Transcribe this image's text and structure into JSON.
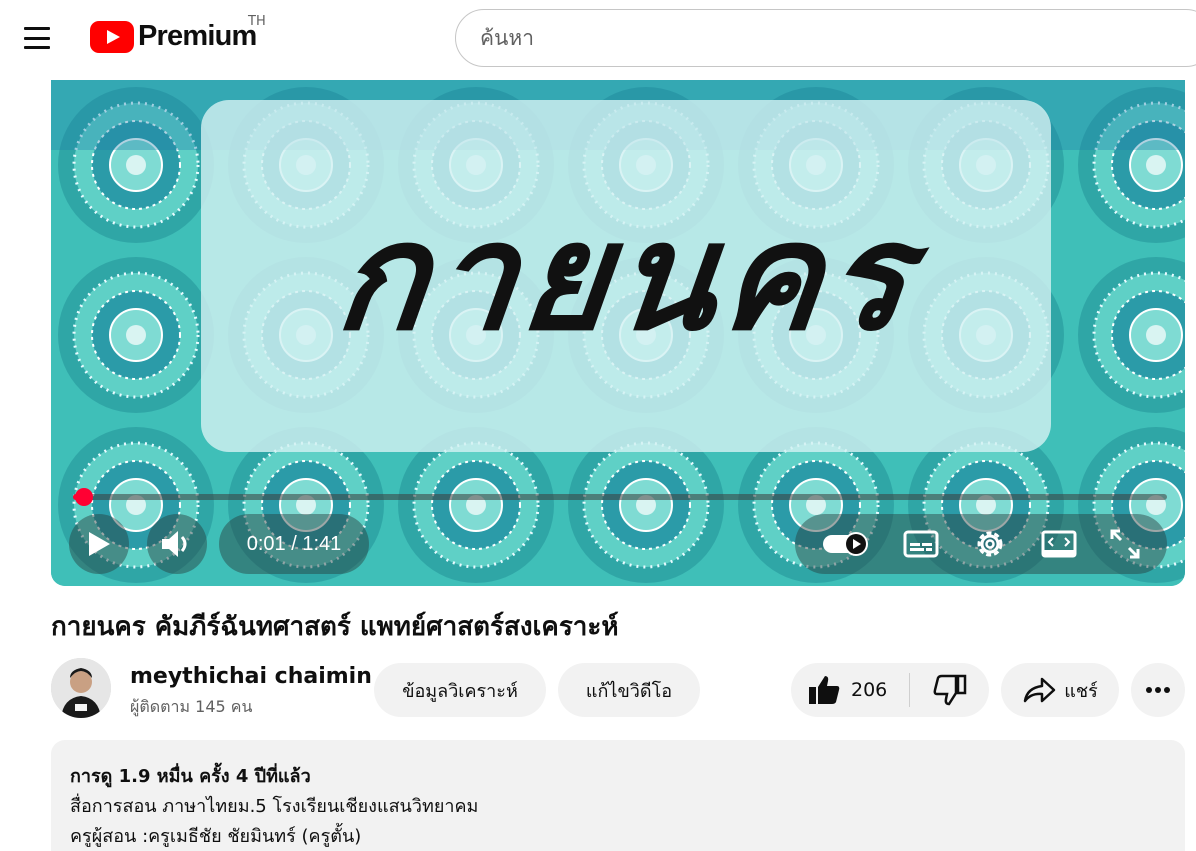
{
  "header": {
    "logo_text": "Premium",
    "country_code": "TH",
    "search_placeholder": "ค้นหา"
  },
  "player": {
    "overlay_text": "กายนคร",
    "current_time": "0:01",
    "duration": "1:41",
    "time_display": "0:01 / 1:41",
    "progress_fraction": 0.01,
    "accent_color": "#ff0033"
  },
  "video": {
    "title": "กายนคร คัมภีร์ฉันทศาสตร์ แพทย์ศาสตร์สงเคราะห์"
  },
  "channel": {
    "name": "meythichai chaimin",
    "subscribers": "ผู้ติดตาม 145 คน"
  },
  "actions": {
    "analytics_label": "ข้อมูลวิเคราะห์",
    "edit_label": "แก้ไขวิดีโอ",
    "like_count": "206",
    "share_label": "แชร์"
  },
  "description": {
    "meta": "การดู 1.9 หมื่น ครั้ง  4 ปีที่แล้ว",
    "line1": "สื่อการสอน ภาษาไทยม.5 โรงเรียนเชียงแสนวิทยาคม",
    "line2": "ครูผู้สอน :ครูเมธีชัย ชัยมินทร์ (ครูตั้น)"
  },
  "icons": [
    "menu-icon",
    "youtube-play-icon",
    "play-icon",
    "volume-icon",
    "autoplay-toggle-icon",
    "subtitles-icon",
    "settings-icon",
    "theater-mode-icon",
    "fullscreen-icon",
    "like-icon",
    "dislike-icon",
    "share-icon",
    "more-icon"
  ]
}
